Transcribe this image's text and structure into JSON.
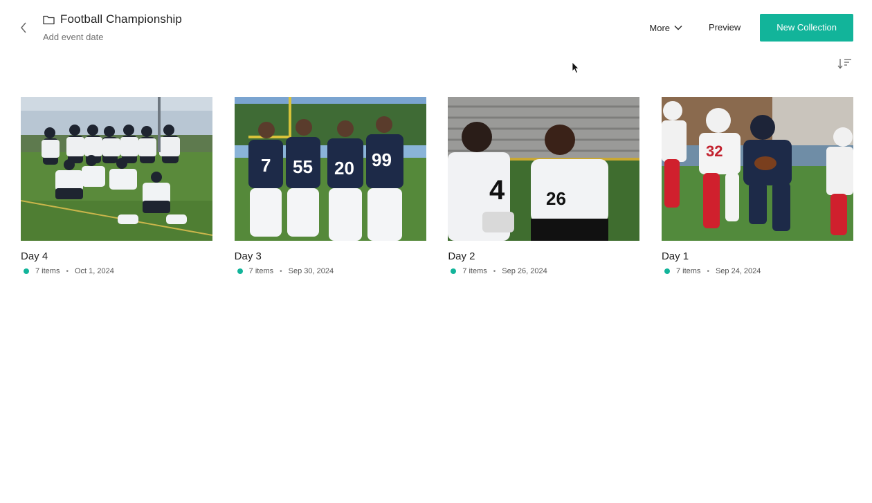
{
  "header": {
    "title": "Football Championship",
    "event_date_label": "Add event date",
    "more_label": "More",
    "preview_label": "Preview",
    "new_collection_label": "New Collection"
  },
  "colors": {
    "accent": "#12b49a"
  },
  "icons": {
    "back": "chevron-left-icon",
    "folder": "folder-icon",
    "more": "chevron-down-icon",
    "sort": "sort-descending-icon",
    "cursor": "mouse-pointer-icon"
  },
  "collections": [
    {
      "title": "Day 4",
      "items": "7 items",
      "date": "Oct 1, 2024"
    },
    {
      "title": "Day 3",
      "items": "7 items",
      "date": "Sep 30, 2024"
    },
    {
      "title": "Day 2",
      "items": "7 items",
      "date": "Sep 26, 2024"
    },
    {
      "title": "Day 1",
      "items": "7 items",
      "date": "Sep 24, 2024"
    }
  ],
  "meta_separator": "•"
}
